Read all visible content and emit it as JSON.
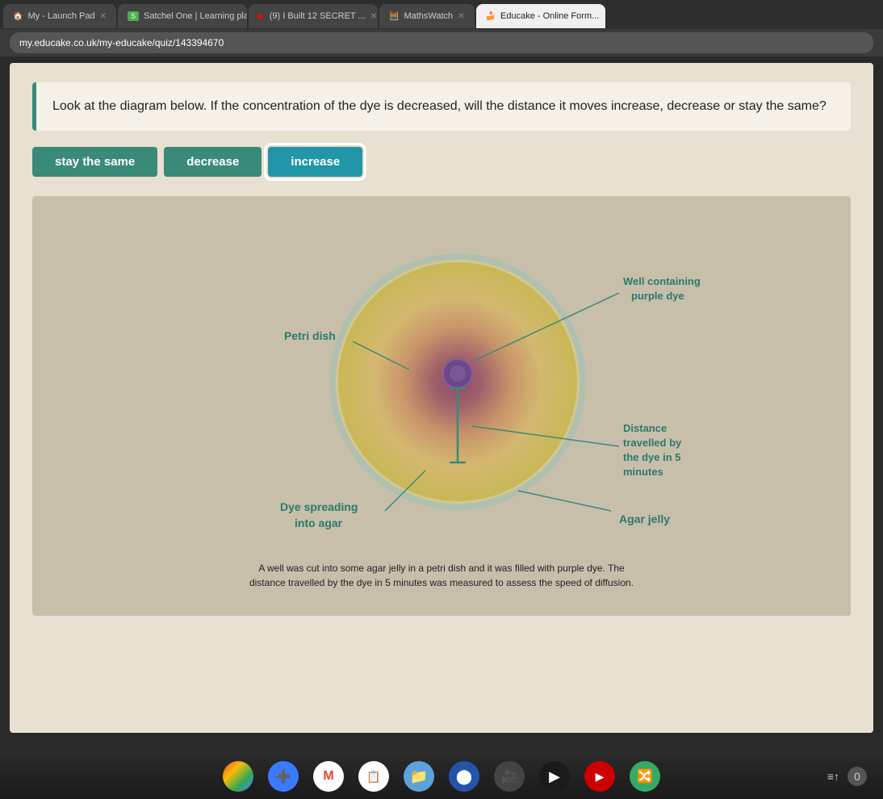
{
  "browser": {
    "tabs": [
      {
        "label": "My - Launch Pad",
        "active": false,
        "icon": "🏠"
      },
      {
        "label": "Satchel One | Learning pla",
        "active": false,
        "icon": "S"
      },
      {
        "label": "(9) I Built 12 SECRET ...",
        "active": false,
        "icon": "▶"
      },
      {
        "label": "MathsWatch",
        "active": false,
        "icon": "🧮"
      },
      {
        "label": "Educake - Online Form...",
        "active": true,
        "icon": "🍰"
      }
    ],
    "address": "my.educake.co.uk/my-educake/quiz/143394670"
  },
  "question": {
    "text": "Look at the diagram below. If the concentration of the dye is decreased, will the distance it moves increase, decrease or stay the same?"
  },
  "answers": [
    {
      "label": "stay the same",
      "selected": false
    },
    {
      "label": "decrease",
      "selected": false
    },
    {
      "label": "increase",
      "selected": true
    }
  ],
  "diagram": {
    "labels": {
      "petri_dish": "Petri dish",
      "well_containing": "Well containing",
      "purple_dye": "purple dye",
      "distance_travelled": "Distance",
      "distance_line2": "travelled by",
      "distance_line3": "the dye in 5",
      "distance_line4": "minutes",
      "dye_spreading": "Dye spreading",
      "into_agar": "into agar",
      "agar_jelly": "Agar jelly"
    },
    "caption": "A well was cut into some agar jelly in a petri dish and it was filled with purple dye. The distance travelled by the dye in 5 minutes was measured to assess the speed of diffusion."
  },
  "taskbar": {
    "icons": [
      "🌐",
      "➕",
      "M",
      "📋",
      "📁",
      "🔵",
      "🎥",
      "▶",
      "📺",
      "🔀"
    ],
    "end_label": "≡↑",
    "end_num": "0"
  }
}
